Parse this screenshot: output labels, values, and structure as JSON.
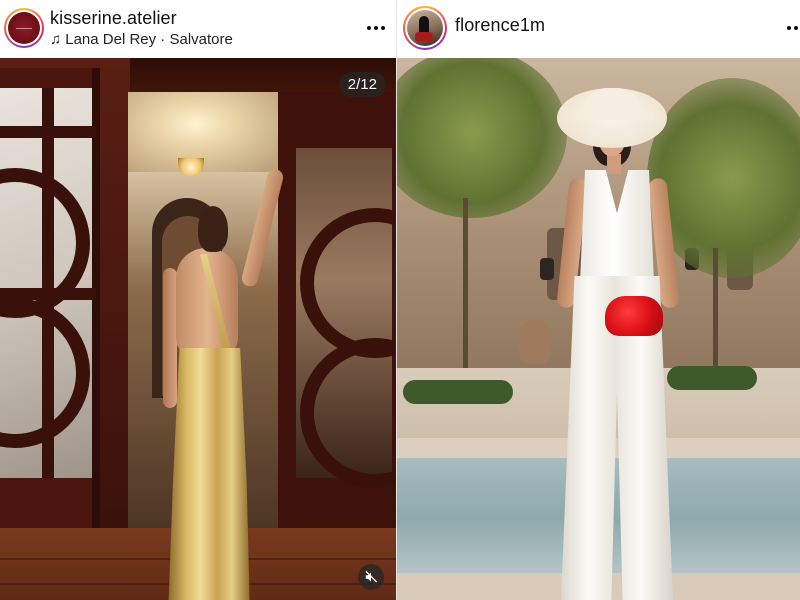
{
  "posts": [
    {
      "username": "kisserine.atelier",
      "audio": "Lana Del Rey · Salvatore",
      "media_counter": "2/12",
      "muted": true
    },
    {
      "username": "florence1m"
    }
  ],
  "icons": {
    "more": "more-horizontal-icon",
    "music": "music-note-icon",
    "mute": "speaker-muted-icon"
  },
  "colors": {
    "story_ring": "#e1306c",
    "badge_bg": "#262626",
    "text": "#111111"
  }
}
